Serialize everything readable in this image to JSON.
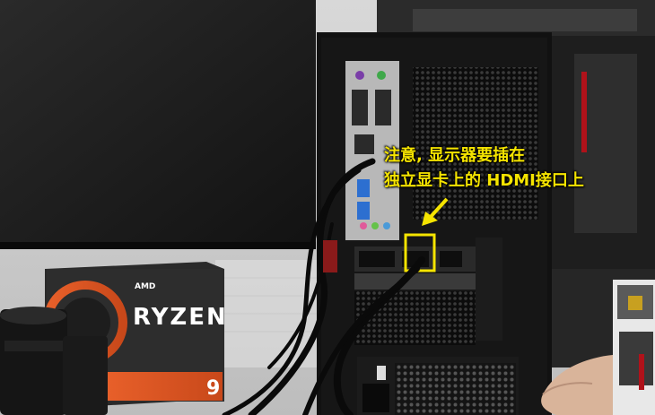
{
  "annotation": {
    "line1": "注意, 显示器要插在",
    "line2": "独立显卡上的 HDMI接口上",
    "color": "#f5e400"
  },
  "product_box": {
    "brand": "AMD",
    "model": "RYZEN",
    "tier": "9"
  },
  "colors": {
    "box_orange": "#e8602a",
    "case_black": "#111111",
    "highlight": "#f5e400"
  }
}
